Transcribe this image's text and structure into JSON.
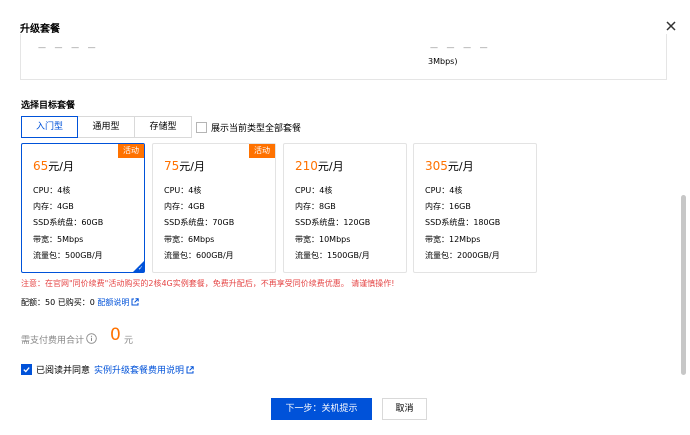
{
  "dialog": {
    "title": "升级套餐",
    "close_icon": "close-icon"
  },
  "current": {
    "clipped_left": "— — — —",
    "clipped_right": "— — — —",
    "bandwidth_tail": "3Mbps)"
  },
  "target": {
    "section_label": "选择目标套餐",
    "tabs": [
      {
        "label": "入门型",
        "active": true
      },
      {
        "label": "通用型",
        "active": false
      },
      {
        "label": "存储型",
        "active": false
      }
    ],
    "show_all_label": "展示当前类型全部套餐",
    "plans": [
      {
        "price": "65",
        "unit": "元/月",
        "badge": "活动",
        "cpu": "CPU：4核",
        "memory": "内存：4GB",
        "disk": "SSD系统盘：60GB",
        "bandwidth": "带宽：5Mbps",
        "traffic": "流量包：500GB/月",
        "selected": true
      },
      {
        "price": "75",
        "unit": "元/月",
        "badge": "活动",
        "cpu": "CPU：4核",
        "memory": "内存：4GB",
        "disk": "SSD系统盘：70GB",
        "bandwidth": "带宽：6Mbps",
        "traffic": "流量包：600GB/月",
        "selected": false
      },
      {
        "price": "210",
        "unit": "元/月",
        "badge": "",
        "cpu": "CPU：4核",
        "memory": "内存：8GB",
        "disk": "SSD系统盘：120GB",
        "bandwidth": "带宽：10Mbps",
        "traffic": "流量包：1500GB/月",
        "selected": false
      },
      {
        "price": "305",
        "unit": "元/月",
        "badge": "",
        "cpu": "CPU：4核",
        "memory": "内存：16GB",
        "disk": "SSD系统盘：180GB",
        "bandwidth": "带宽：12Mbps",
        "traffic": "流量包：2000GB/月",
        "selected": false
      }
    ]
  },
  "notice": "注意：在官网\"同价续费\"活动购买的2核4G实例套餐，免费升配后，不再享受同价续费优惠。 请谨慎操作!",
  "quota": {
    "label": "配额：",
    "quota_value": "50",
    "bought_label": "已购买：",
    "bought_value": "0",
    "link": "配额说明"
  },
  "fee": {
    "label": "需支付费用合计",
    "amount": "0",
    "unit": "元"
  },
  "agree": {
    "checked": true,
    "text": "已阅读并同意",
    "link": "实例升级套餐费用说明"
  },
  "buttons": {
    "next": "下一步：关机提示",
    "cancel": "取消"
  },
  "colors": {
    "primary": "#0052d9",
    "accent": "#ff7200",
    "warning_text": "#e54545"
  }
}
